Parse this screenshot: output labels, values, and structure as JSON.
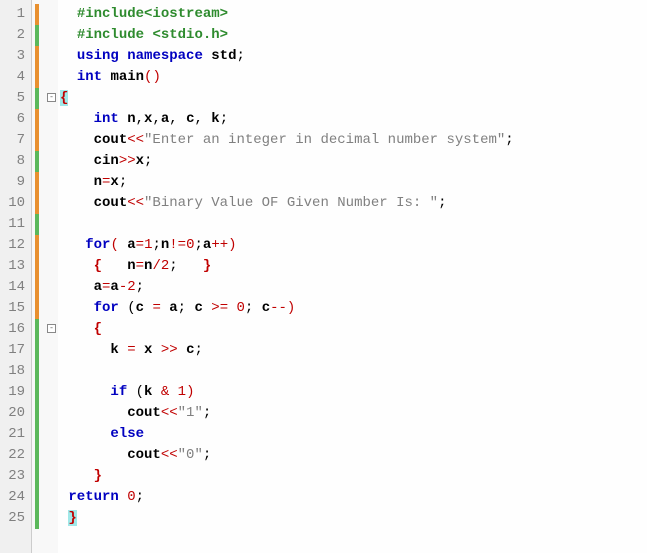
{
  "editor": {
    "lineCount": 25,
    "margins": [
      {
        "line": 1,
        "color": "orange"
      },
      {
        "line": 2,
        "color": "green"
      },
      {
        "line": 3,
        "color": "orange"
      },
      {
        "line": 4,
        "color": "orange"
      },
      {
        "line": 5,
        "color": "green"
      },
      {
        "line": 6,
        "color": "orange"
      },
      {
        "line": 7,
        "color": "orange"
      },
      {
        "line": 8,
        "color": "green"
      },
      {
        "line": 9,
        "color": "orange"
      },
      {
        "line": 10,
        "color": "orange"
      },
      {
        "line": 11,
        "color": "green"
      },
      {
        "line": 12,
        "color": "orange"
      },
      {
        "line": 13,
        "color": "orange"
      },
      {
        "line": 14,
        "color": "orange"
      },
      {
        "line": 15,
        "color": "orange"
      },
      {
        "line": 16,
        "color": "green"
      },
      {
        "line": 17,
        "color": "green"
      },
      {
        "line": 18,
        "color": "green"
      },
      {
        "line": 19,
        "color": "green"
      },
      {
        "line": 20,
        "color": "green"
      },
      {
        "line": 21,
        "color": "green"
      },
      {
        "line": 22,
        "color": "green"
      },
      {
        "line": 23,
        "color": "green"
      },
      {
        "line": 24,
        "color": "green"
      },
      {
        "line": 25,
        "color": "green"
      }
    ],
    "folds": [
      {
        "line": 5,
        "sym": "-"
      },
      {
        "line": 16,
        "sym": "-"
      }
    ],
    "lines": [
      {
        "indent": "  ",
        "tokens": [
          {
            "t": "#include",
            "c": "c-preproc"
          },
          {
            "t": "<iostream>",
            "c": "c-preproc"
          }
        ]
      },
      {
        "indent": "  ",
        "tokens": [
          {
            "t": "#include ",
            "c": "c-preproc"
          },
          {
            "t": "<stdio.h>",
            "c": "c-preproc"
          }
        ]
      },
      {
        "indent": "  ",
        "tokens": [
          {
            "t": "using",
            "c": "c-keyword"
          },
          {
            "t": " "
          },
          {
            "t": "namespace",
            "c": "c-keyword"
          },
          {
            "t": " "
          },
          {
            "t": "std",
            "c": "c-ident"
          },
          {
            "t": ";",
            "c": "c-punct"
          }
        ]
      },
      {
        "indent": "  ",
        "tokens": [
          {
            "t": "int",
            "c": "c-keyword"
          },
          {
            "t": " "
          },
          {
            "t": "main",
            "c": "c-ident"
          },
          {
            "t": "()",
            "c": "c-op"
          }
        ]
      },
      {
        "indent": "",
        "tokens": [
          {
            "t": "{",
            "c": "c-brace hl-brace"
          }
        ]
      },
      {
        "indent": "    ",
        "tokens": [
          {
            "t": "int",
            "c": "c-keyword"
          },
          {
            "t": " "
          },
          {
            "t": "n",
            "c": "c-ident"
          },
          {
            "t": ",",
            "c": "c-punct"
          },
          {
            "t": "x",
            "c": "c-ident"
          },
          {
            "t": ",",
            "c": "c-punct"
          },
          {
            "t": "a",
            "c": "c-ident"
          },
          {
            "t": ", ",
            "c": "c-punct"
          },
          {
            "t": "c",
            "c": "c-ident"
          },
          {
            "t": ", ",
            "c": "c-punct"
          },
          {
            "t": "k",
            "c": "c-ident"
          },
          {
            "t": ";",
            "c": "c-punct"
          }
        ]
      },
      {
        "indent": "    ",
        "tokens": [
          {
            "t": "cout",
            "c": "c-ident"
          },
          {
            "t": "<<",
            "c": "c-op"
          },
          {
            "t": "\"Enter an integer in decimal number system\"",
            "c": "c-string"
          },
          {
            "t": ";",
            "c": "c-punct"
          }
        ]
      },
      {
        "indent": "    ",
        "tokens": [
          {
            "t": "cin",
            "c": "c-ident"
          },
          {
            "t": ">>",
            "c": "c-op"
          },
          {
            "t": "x",
            "c": "c-ident"
          },
          {
            "t": ";",
            "c": "c-punct"
          }
        ]
      },
      {
        "indent": "    ",
        "tokens": [
          {
            "t": "n",
            "c": "c-ident"
          },
          {
            "t": "=",
            "c": "c-op"
          },
          {
            "t": "x",
            "c": "c-ident"
          },
          {
            "t": ";",
            "c": "c-punct"
          }
        ]
      },
      {
        "indent": "    ",
        "tokens": [
          {
            "t": "cout",
            "c": "c-ident"
          },
          {
            "t": "<<",
            "c": "c-op"
          },
          {
            "t": "\"Binary Value OF Given Number Is: \"",
            "c": "c-string"
          },
          {
            "t": ";",
            "c": "c-punct"
          }
        ]
      },
      {
        "indent": "",
        "tokens": []
      },
      {
        "indent": "   ",
        "tokens": [
          {
            "t": "for",
            "c": "c-keyword"
          },
          {
            "t": "( ",
            "c": "c-op"
          },
          {
            "t": "a",
            "c": "c-ident"
          },
          {
            "t": "=",
            "c": "c-op"
          },
          {
            "t": "1",
            "c": "c-number"
          },
          {
            "t": ";",
            "c": "c-punct"
          },
          {
            "t": "n",
            "c": "c-ident"
          },
          {
            "t": "!=",
            "c": "c-op"
          },
          {
            "t": "0",
            "c": "c-number"
          },
          {
            "t": ";",
            "c": "c-punct"
          },
          {
            "t": "a",
            "c": "c-ident"
          },
          {
            "t": "++)",
            "c": "c-op"
          }
        ]
      },
      {
        "indent": "    ",
        "tokens": [
          {
            "t": "{",
            "c": "c-brace"
          },
          {
            "t": "   "
          },
          {
            "t": "n",
            "c": "c-ident"
          },
          {
            "t": "=",
            "c": "c-op"
          },
          {
            "t": "n",
            "c": "c-ident"
          },
          {
            "t": "/",
            "c": "c-op"
          },
          {
            "t": "2",
            "c": "c-number"
          },
          {
            "t": ";",
            "c": "c-punct"
          },
          {
            "t": "   "
          },
          {
            "t": "}",
            "c": "c-brace"
          }
        ]
      },
      {
        "indent": "    ",
        "tokens": [
          {
            "t": "a",
            "c": "c-ident"
          },
          {
            "t": "=",
            "c": "c-op"
          },
          {
            "t": "a",
            "c": "c-ident"
          },
          {
            "t": "-",
            "c": "c-op"
          },
          {
            "t": "2",
            "c": "c-number"
          },
          {
            "t": ";",
            "c": "c-punct"
          }
        ]
      },
      {
        "indent": "    ",
        "tokens": [
          {
            "t": "for",
            "c": "c-keyword"
          },
          {
            "t": " ("
          },
          {
            "t": "c",
            "c": "c-ident"
          },
          {
            "t": " = ",
            "c": "c-op"
          },
          {
            "t": "a",
            "c": "c-ident"
          },
          {
            "t": "; ",
            "c": "c-punct"
          },
          {
            "t": "c",
            "c": "c-ident"
          },
          {
            "t": " >= ",
            "c": "c-op"
          },
          {
            "t": "0",
            "c": "c-number"
          },
          {
            "t": "; ",
            "c": "c-punct"
          },
          {
            "t": "c",
            "c": "c-ident"
          },
          {
            "t": "--)",
            "c": "c-op"
          }
        ]
      },
      {
        "indent": "    ",
        "tokens": [
          {
            "t": "{",
            "c": "c-brace"
          }
        ]
      },
      {
        "indent": "      ",
        "tokens": [
          {
            "t": "k",
            "c": "c-ident"
          },
          {
            "t": " = ",
            "c": "c-op"
          },
          {
            "t": "x",
            "c": "c-ident"
          },
          {
            "t": " >> ",
            "c": "c-op"
          },
          {
            "t": "c",
            "c": "c-ident"
          },
          {
            "t": ";",
            "c": "c-punct"
          }
        ]
      },
      {
        "indent": "",
        "tokens": []
      },
      {
        "indent": "      ",
        "tokens": [
          {
            "t": "if",
            "c": "c-keyword"
          },
          {
            "t": " ("
          },
          {
            "t": "k",
            "c": "c-ident"
          },
          {
            "t": " & ",
            "c": "c-op"
          },
          {
            "t": "1",
            "c": "c-number"
          },
          {
            "t": ")",
            "c": "c-op"
          }
        ]
      },
      {
        "indent": "        ",
        "tokens": [
          {
            "t": "cout",
            "c": "c-ident"
          },
          {
            "t": "<<",
            "c": "c-op"
          },
          {
            "t": "\"1\"",
            "c": "c-string"
          },
          {
            "t": ";",
            "c": "c-punct"
          }
        ]
      },
      {
        "indent": "      ",
        "tokens": [
          {
            "t": "else",
            "c": "c-keyword"
          }
        ]
      },
      {
        "indent": "        ",
        "tokens": [
          {
            "t": "cout",
            "c": "c-ident"
          },
          {
            "t": "<<",
            "c": "c-op"
          },
          {
            "t": "\"0\"",
            "c": "c-string"
          },
          {
            "t": ";",
            "c": "c-punct"
          }
        ]
      },
      {
        "indent": "    ",
        "tokens": [
          {
            "t": "}",
            "c": "c-brace"
          }
        ]
      },
      {
        "indent": " ",
        "tokens": [
          {
            "t": "return",
            "c": "c-keyword"
          },
          {
            "t": " "
          },
          {
            "t": "0",
            "c": "c-number"
          },
          {
            "t": ";",
            "c": "c-punct"
          }
        ]
      },
      {
        "indent": " ",
        "tokens": [
          {
            "t": "}",
            "c": "c-brace hl-brace"
          }
        ]
      }
    ]
  }
}
